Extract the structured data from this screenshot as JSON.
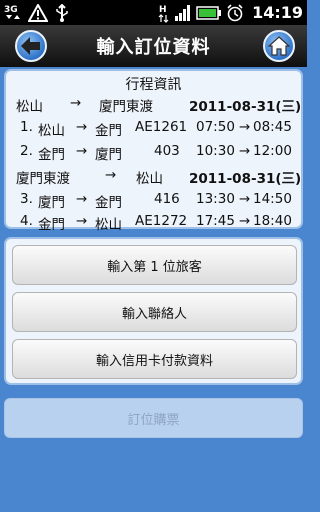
{
  "status_bar": {
    "network": "3G",
    "data_h": "H",
    "time": "14:19"
  },
  "header": {
    "title": "輸入訂位資料",
    "back_icon": "arrow-left-icon",
    "home_icon": "home-icon"
  },
  "itinerary": {
    "title": "行程資訊",
    "segments": [
      {
        "from": "松山",
        "arrow": "→",
        "to": "廈門東渡",
        "date": "2011-08-31(三)",
        "flights": [
          {
            "no": "1.",
            "from": "松山",
            "arrow": "→",
            "to": "金門",
            "flight": "AE1261",
            "dep": "07:50",
            "sep": "→",
            "arr": "08:45"
          },
          {
            "no": "2.",
            "from": "金門",
            "arrow": "→",
            "to": "廈門",
            "flight": "403",
            "dep": "10:30",
            "sep": "→",
            "arr": "12:00"
          }
        ]
      },
      {
        "from": "廈門東渡",
        "arrow": "→",
        "to": "松山",
        "date": "2011-08-31(三)",
        "flights": [
          {
            "no": "3.",
            "from": "廈門",
            "arrow": "→",
            "to": "金門",
            "flight": "416",
            "dep": "13:30",
            "sep": "→",
            "arr": "14:50"
          },
          {
            "no": "4.",
            "from": "金門",
            "arrow": "→",
            "to": "松山",
            "flight": "AE1272",
            "dep": "17:45",
            "sep": "→",
            "arr": "18:40"
          }
        ]
      }
    ]
  },
  "actions": {
    "passenger": "輸入第 1 位旅客",
    "contact": "輸入聯絡人",
    "payment": "輸入信用卡付款資料"
  },
  "booking": {
    "label": "訂位購票"
  },
  "colors": {
    "background": "#4a86d0",
    "card": "#eef4fb",
    "disabled_button": "#b8d1ee"
  }
}
